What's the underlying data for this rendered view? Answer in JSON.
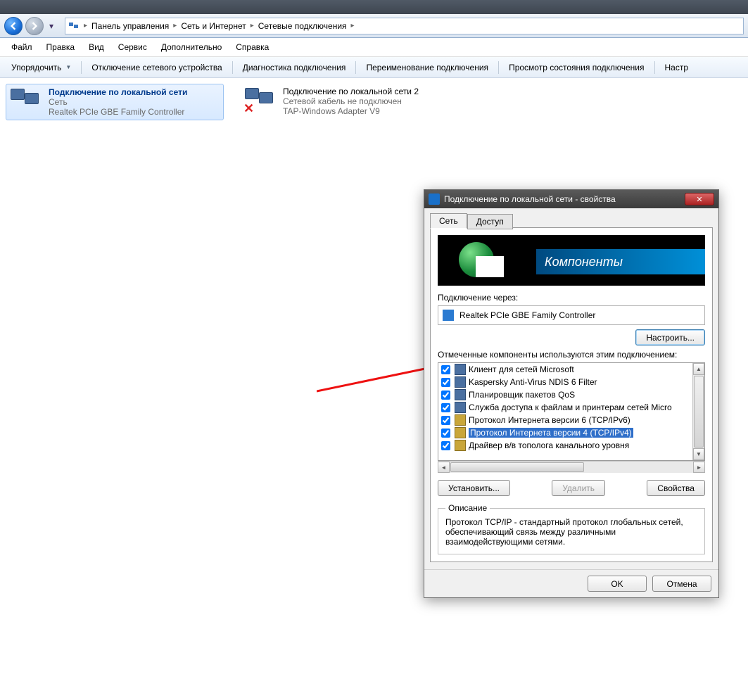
{
  "breadcrumb": {
    "items": [
      "Панель управления",
      "Сеть и Интернет",
      "Сетевые подключения"
    ]
  },
  "menu": {
    "file": "Файл",
    "edit": "Правка",
    "view": "Вид",
    "tools": "Сервис",
    "advanced": "Дополнительно",
    "help": "Справка"
  },
  "cmdbar": {
    "organize": "Упорядочить",
    "disable": "Отключение сетевого устройства",
    "diagnose": "Диагностика подключения",
    "rename": "Переименование подключения",
    "status": "Просмотр состояния подключения",
    "settings": "Настр"
  },
  "connections": [
    {
      "title": "Подключение по локальной сети",
      "line1": "Сеть",
      "line2": "Realtek PCIe GBE Family Controller",
      "disconnected": false
    },
    {
      "title": "Подключение по локальной сети 2",
      "line1": "Сетевой кабель не подключен",
      "line2": "TAP-Windows Adapter V9",
      "disconnected": true
    }
  ],
  "dialog": {
    "title": "Подключение по локальной сети - свойства",
    "tabs": {
      "network": "Сеть",
      "access": "Доступ"
    },
    "banner": "Компоненты",
    "connect_via_label": "Подключение через:",
    "adapter": "Realtek PCIe GBE Family Controller",
    "configure_btn": "Настроить...",
    "checked_label": "Отмеченные компоненты используются этим подключением:",
    "components": [
      {
        "checked": true,
        "label": "Клиент для сетей Microsoft",
        "icon": "net"
      },
      {
        "checked": true,
        "label": "Kaspersky Anti-Virus NDIS 6 Filter",
        "icon": "net"
      },
      {
        "checked": true,
        "label": "Планировщик пакетов QoS",
        "icon": "net"
      },
      {
        "checked": true,
        "label": "Служба доступа к файлам и принтерам сетей Micro",
        "icon": "net"
      },
      {
        "checked": true,
        "label": "Протокол Интернета версии 6 (TCP/IPv6)",
        "icon": "proto"
      },
      {
        "checked": true,
        "label": "Протокол Интернета версии 4 (TCP/IPv4)",
        "icon": "proto",
        "selected": true
      },
      {
        "checked": true,
        "label": "Драйвер в/в тополога канального уровня",
        "icon": "proto"
      }
    ],
    "install_btn": "Установить...",
    "remove_btn": "Удалить",
    "properties_btn": "Свойства",
    "desc_title": "Описание",
    "desc_text": "Протокол TCP/IP - стандартный протокол глобальных сетей, обеспечивающий связь между различными взаимодействующими сетями.",
    "ok": "OK",
    "cancel": "Отмена"
  }
}
